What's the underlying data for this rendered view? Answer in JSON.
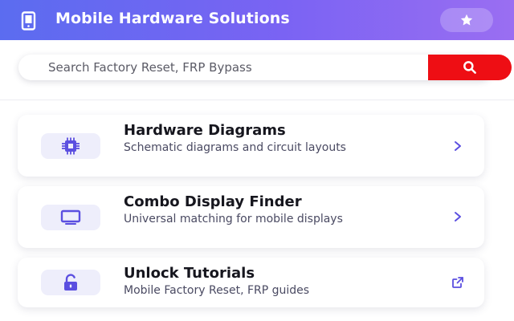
{
  "header": {
    "title": "Mobile Hardware Solutions",
    "logo_icon": "smartphone-icon",
    "favorite_icon": "star-icon"
  },
  "search": {
    "placeholder": "Search Factory Reset, FRP Bypass",
    "value": "",
    "button_icon": "search-icon"
  },
  "colors": {
    "header_start": "#5b6cf0",
    "header_end": "#9a6ef2",
    "accent": "#5b4fe0",
    "search_button": "#ee0e14",
    "icon_bg": "#eeeefb"
  },
  "cards": [
    {
      "title": "Hardware Diagrams",
      "description": "Schematic diagrams and circuit layouts",
      "icon": "chip-icon",
      "action_icon": "chevron-right-icon"
    },
    {
      "title": "Combo Display Finder",
      "description": "Universal matching for mobile displays",
      "icon": "monitor-icon",
      "action_icon": "chevron-right-icon"
    },
    {
      "title": "Unlock Tutorials",
      "description": "Mobile Factory Reset, FRP guides",
      "icon": "unlock-icon",
      "action_icon": "external-link-icon"
    }
  ]
}
